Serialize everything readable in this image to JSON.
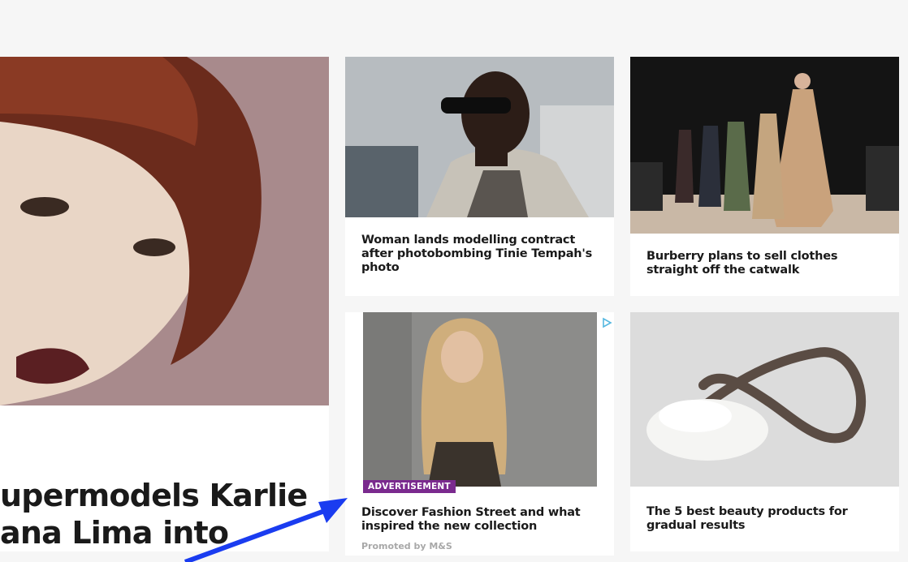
{
  "feature": {
    "title_line1": "upermodels Karlie",
    "title_line2": "ana Lima into"
  },
  "cards": [
    {
      "title": "Woman lands modelling contract after photobombing Tinie Tempah's photo"
    },
    {
      "title": "Burberry plans to sell clothes straight off the catwalk"
    },
    {
      "badge": "ADVERTISEMENT",
      "title": "Discover Fashion Street and what inspired the new collection",
      "promoted": "Promoted by M&S",
      "adchoices_icon": "adchoices-icon"
    },
    {
      "title": "The 5 best beauty products for gradual results"
    }
  ],
  "annotation": {
    "arrow_color": "#1a3cf0"
  }
}
